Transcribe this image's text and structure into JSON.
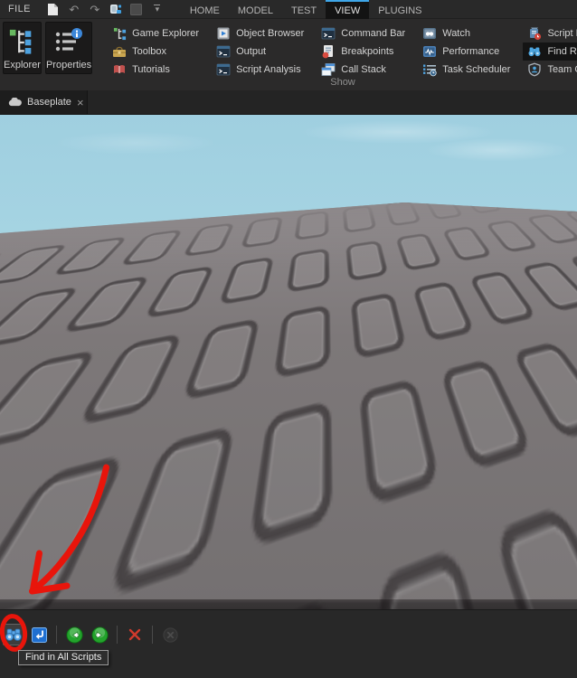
{
  "colors": {
    "accent_blue": "#3fa6e8",
    "annotation_red": "#e8150b",
    "sky_top": "#9fcfe0",
    "sky_horizon": "#c7e4e6",
    "ground_gray": "#7b7678",
    "find_icon_blue": "#4da6e0"
  },
  "menu_bar": {
    "file_label": "FILE",
    "quick_access_icons": [
      "new-file",
      "undo",
      "redo",
      "insert-part",
      "inactive-box",
      "customize-caret"
    ],
    "tabs": [
      {
        "label": "HOME",
        "active": false
      },
      {
        "label": "MODEL",
        "active": false
      },
      {
        "label": "TEST",
        "active": false
      },
      {
        "label": "VIEW",
        "active": true
      },
      {
        "label": "PLUGINS",
        "active": false
      }
    ]
  },
  "icons": {
    "undo": "↶",
    "redo": "↷",
    "caret": "▾",
    "tab_close": "×"
  },
  "ribbon": {
    "group_label": "Show",
    "big_buttons": [
      {
        "label": "Explorer"
      },
      {
        "label": "Properties"
      }
    ],
    "columns": [
      {
        "items": [
          {
            "label": "Game Explorer"
          },
          {
            "label": "Toolbox"
          },
          {
            "label": "Tutorials"
          }
        ]
      },
      {
        "items": [
          {
            "label": "Object Browser"
          },
          {
            "label": "Output"
          },
          {
            "label": "Script Analysis"
          }
        ]
      },
      {
        "items": [
          {
            "label": "Command Bar"
          },
          {
            "label": "Breakpoints"
          },
          {
            "label": "Call Stack"
          }
        ]
      },
      {
        "items": [
          {
            "label": "Watch"
          },
          {
            "label": "Performance"
          },
          {
            "label": "Task Scheduler"
          }
        ]
      },
      {
        "items": [
          {
            "label": "Script Performance"
          },
          {
            "label": "Find Results",
            "active": true
          },
          {
            "label": "Team Create"
          }
        ]
      }
    ]
  },
  "tab_bar": {
    "tabs": [
      {
        "label": "Baseplate"
      }
    ]
  },
  "viewport": {
    "scene": "empty baseplate with studded texture under light blue sky"
  },
  "find_results_panel": {
    "tooltip": "Find in All Scripts",
    "buttons": [
      {
        "name": "find-in-all-scripts",
        "tooltip": "Find in All Scripts",
        "state": "hovered"
      },
      {
        "name": "replace-in-all-scripts",
        "state": "normal"
      },
      {
        "name": "previous-result",
        "state": "normal"
      },
      {
        "name": "next-result",
        "state": "normal"
      },
      {
        "name": "clear-results",
        "state": "normal"
      },
      {
        "name": "stop-search",
        "state": "disabled"
      }
    ]
  },
  "annotation": {
    "color": "#e8150b",
    "shapes": [
      "hand-drawn circle around Find in All Scripts button",
      "hand-drawn arrow pointing to it"
    ]
  }
}
